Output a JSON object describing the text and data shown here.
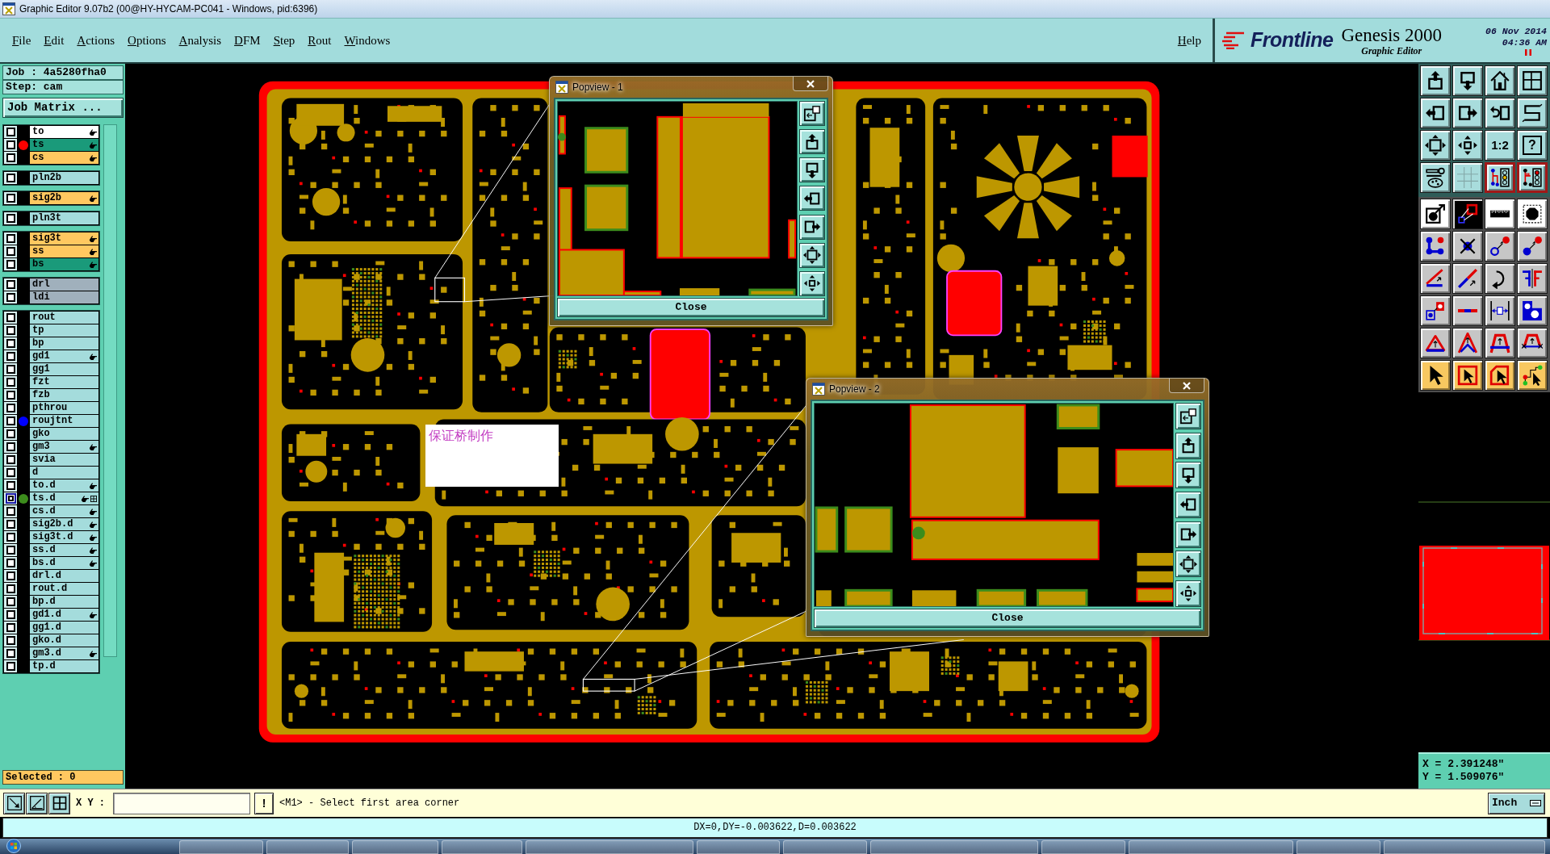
{
  "window": {
    "title": "Graphic Editor 9.07b2 (00@HY-HYCAM-PC041 - Windows, pid:6396)"
  },
  "menu": {
    "items": [
      "File",
      "Edit",
      "Actions",
      "Options",
      "Analysis",
      "DFM",
      "Step",
      "Rout",
      "Windows"
    ],
    "help": "Help"
  },
  "brand": {
    "logo": "Frontline",
    "product": "Genesis 2000",
    "module": "Graphic Editor",
    "date": "06 Nov 2014",
    "time": "04:36 AM"
  },
  "job_panel": {
    "job": "Job : 4a5280fha0",
    "step": "Step: cam",
    "matrix_button": "Job Matrix ...",
    "layer_groups": [
      {
        "layers": [
          {
            "name": "to",
            "color": "#ffffff",
            "selected": false,
            "flagged": true,
            "grid_mark": false
          },
          {
            "name": "ts",
            "color": "#1a9a7a",
            "dot": {
              "color": "#ff0000"
            },
            "selected": false,
            "flagged": true,
            "grid_mark": false
          },
          {
            "name": "cs",
            "color": "#ffc860",
            "selected": false,
            "flagged": true,
            "grid_mark": false
          }
        ]
      },
      {
        "layers": [
          {
            "name": "pln2b",
            "color": "#a4dcdc",
            "selected": false,
            "flagged": false,
            "grid_mark": false
          }
        ]
      },
      {
        "layers": [
          {
            "name": "sig2b",
            "color": "#ffc860",
            "selected": false,
            "flagged": true,
            "grid_mark": false
          }
        ]
      },
      {
        "layers": [
          {
            "name": "pln3t",
            "color": "#a4dcdc",
            "selected": false,
            "flagged": false,
            "grid_mark": false
          }
        ]
      },
      {
        "layers": [
          {
            "name": "sig3t",
            "color": "#ffc860",
            "selected": false,
            "flagged": true,
            "grid_mark": false
          },
          {
            "name": "ss",
            "color": "#ffc860",
            "selected": false,
            "flagged": true,
            "grid_mark": false
          },
          {
            "name": "bs",
            "color": "#1a9a7a",
            "selected": false,
            "flagged": true,
            "grid_mark": false
          }
        ]
      },
      {
        "layers": [
          {
            "name": "drl",
            "color": "#a0b0bc",
            "selected": false,
            "flagged": false,
            "grid_mark": false
          },
          {
            "name": "ldi",
            "color": "#a0b0bc",
            "selected": false,
            "flagged": false,
            "grid_mark": false
          }
        ]
      },
      {
        "layers": [
          {
            "name": "rout",
            "color": "#a4dcdc",
            "selected": false,
            "flagged": false,
            "grid_mark": false
          },
          {
            "name": "tp",
            "color": "#a4dcdc",
            "selected": false,
            "flagged": false,
            "grid_mark": false
          },
          {
            "name": "bp",
            "color": "#a4dcdc",
            "selected": false,
            "flagged": false,
            "grid_mark": false
          },
          {
            "name": "gd1",
            "color": "#a4dcdc",
            "selected": false,
            "flagged": true,
            "grid_mark": false
          },
          {
            "name": "gg1",
            "color": "#a4dcdc",
            "selected": false,
            "flagged": false,
            "grid_mark": false
          },
          {
            "name": "fzt",
            "color": "#a4dcdc",
            "selected": false,
            "flagged": false,
            "grid_mark": false
          },
          {
            "name": "fzb",
            "color": "#a4dcdc",
            "selected": false,
            "flagged": false,
            "grid_mark": false
          },
          {
            "name": "pthrou",
            "color": "#a4dcdc",
            "selected": false,
            "flagged": false,
            "grid_mark": false
          },
          {
            "name": "roujtnt",
            "color": "#a4dcdc",
            "dot": {
              "color": "#0000ff"
            },
            "selected": false,
            "flagged": false,
            "grid_mark": false
          },
          {
            "name": "gko",
            "color": "#a4dcdc",
            "selected": false,
            "flagged": false,
            "grid_mark": false
          },
          {
            "name": "gm3",
            "color": "#a4dcdc",
            "selected": false,
            "flagged": true,
            "grid_mark": false
          },
          {
            "name": "svia",
            "color": "#a4dcdc",
            "selected": false,
            "flagged": false,
            "grid_mark": false
          },
          {
            "name": "d",
            "color": "#a4dcdc",
            "selected": false,
            "flagged": false,
            "grid_mark": false
          },
          {
            "name": "to.d",
            "color": "#a4dcdc",
            "selected": false,
            "flagged": true,
            "grid_mark": false
          },
          {
            "name": "ts.d",
            "color": "#a4dcdc",
            "dot": {
              "color": "#3c8c1c"
            },
            "selected": true,
            "flagged": true,
            "grid_mark": true
          },
          {
            "name": "cs.d",
            "color": "#a4dcdc",
            "selected": false,
            "flagged": true,
            "grid_mark": false
          },
          {
            "name": "sig2b.d",
            "color": "#a4dcdc",
            "selected": false,
            "flagged": true,
            "grid_mark": false
          },
          {
            "name": "sig3t.d",
            "color": "#a4dcdc",
            "selected": false,
            "flagged": true,
            "grid_mark": false
          },
          {
            "name": "ss.d",
            "color": "#a4dcdc",
            "selected": false,
            "flagged": true,
            "grid_mark": false
          },
          {
            "name": "bs.d",
            "color": "#a4dcdc",
            "selected": false,
            "flagged": true,
            "grid_mark": false
          },
          {
            "name": "drl.d",
            "color": "#a4dcdc",
            "selected": false,
            "flagged": false,
            "grid_mark": false
          },
          {
            "name": "rout.d",
            "color": "#a4dcdc",
            "selected": false,
            "flagged": false,
            "grid_mark": false
          },
          {
            "name": "bp.d",
            "color": "#a4dcdc",
            "selected": false,
            "flagged": false,
            "grid_mark": false
          },
          {
            "name": "gd1.d",
            "color": "#a4dcdc",
            "selected": false,
            "flagged": true,
            "grid_mark": false
          },
          {
            "name": "gg1.d",
            "color": "#a4dcdc",
            "selected": false,
            "flagged": false,
            "grid_mark": false
          },
          {
            "name": "gko.d",
            "color": "#a4dcdc",
            "selected": false,
            "flagged": false,
            "grid_mark": false
          },
          {
            "name": "gm3.d",
            "color": "#a4dcdc",
            "selected": false,
            "flagged": true,
            "grid_mark": false
          },
          {
            "name": "tp.d",
            "color": "#a4dcdc",
            "selected": false,
            "flagged": false,
            "grid_mark": false
          }
        ]
      }
    ],
    "selected": "Selected : 0"
  },
  "canvas": {
    "note": "保证桥制作"
  },
  "popviews": [
    {
      "title": "Popview - 1",
      "close_button": "Close"
    },
    {
      "title": "Popview - 2",
      "close_button": "Close"
    }
  ],
  "tool_palette": {
    "button_texts": [
      "1:2",
      "?"
    ]
  },
  "coordinates": {
    "x": "X = 2.391248\"",
    "y": "Y = 1.509076\""
  },
  "command_bar": {
    "xy_label": "X Y :",
    "bang_button": "!",
    "prompt": "<M1> - Select first area corner",
    "units": "Inch"
  },
  "status_bar": {
    "text": "DX=0,DY=-0.003622,D=0.003622"
  }
}
